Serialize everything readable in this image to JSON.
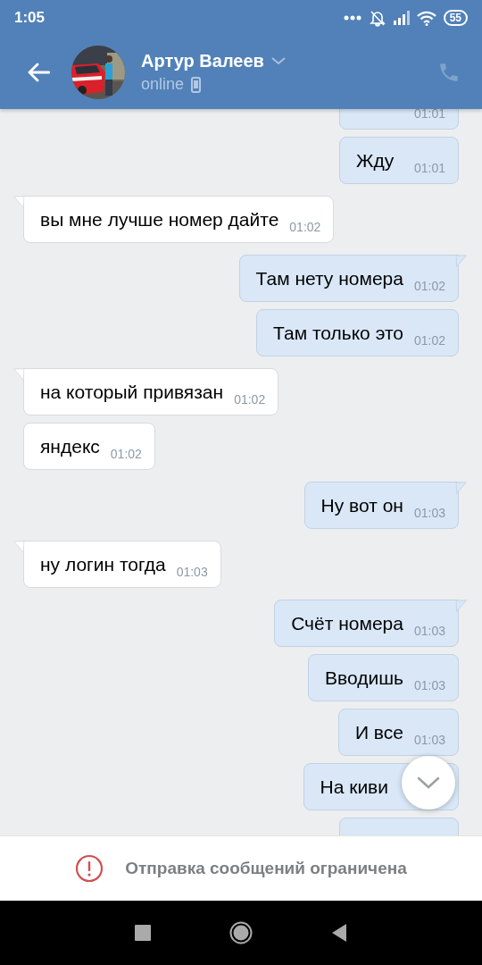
{
  "status_bar": {
    "time": "1:05",
    "battery": "55"
  },
  "header": {
    "name": "Артур Валеев",
    "status": "online"
  },
  "messages": [
    {
      "kind": "outgoing",
      "time": "01:01"
    },
    {
      "kind": "outgoing",
      "tail": false,
      "text": "Жду",
      "time": "01:01"
    },
    {
      "kind": "incoming",
      "tail": true,
      "text": "вы мне лучше номер дайте",
      "time": "01:02"
    },
    {
      "kind": "outgoing",
      "tail": true,
      "text": "Там нету номера",
      "time": "01:02"
    },
    {
      "kind": "outgoing",
      "tail": false,
      "text": "Там только это",
      "time": "01:02"
    },
    {
      "kind": "incoming",
      "tail": true,
      "text": "на который привязан",
      "time": "01:02"
    },
    {
      "kind": "incoming",
      "tail": false,
      "text": "яндекс",
      "time": "01:02"
    },
    {
      "kind": "outgoing",
      "tail": true,
      "text": "Ну вот он",
      "time": "01:03"
    },
    {
      "kind": "incoming",
      "tail": true,
      "text": "ну логин тогда",
      "time": "01:03"
    },
    {
      "kind": "outgoing",
      "tail": true,
      "text": "Счёт номера",
      "time": "01:03"
    },
    {
      "kind": "outgoing",
      "tail": false,
      "text": "Вводишь",
      "time": "01:03"
    },
    {
      "kind": "outgoing",
      "tail": false,
      "text": "И все",
      "time": "01:03"
    },
    {
      "kind": "outgoing",
      "tail": false,
      "text": "На киви"
    },
    {
      "kind": "outgoing"
    }
  ],
  "notice": "Отправка сообщений ограничена"
}
